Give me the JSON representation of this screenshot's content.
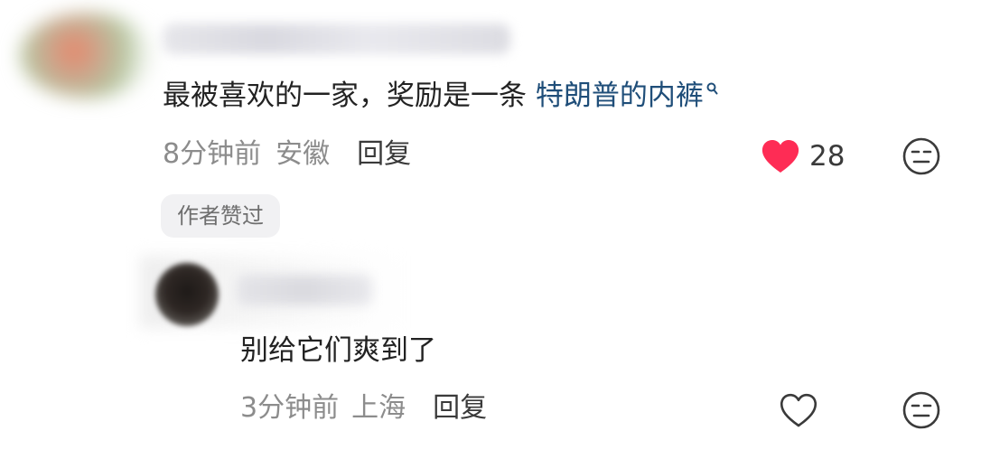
{
  "comment": {
    "text": "最被喜欢的一家，奖励是一条 ",
    "link_text": "特朗普的内裤",
    "time": "8分钟前",
    "location": "安徽",
    "reply_label": "回复",
    "like_count": "28",
    "liked": true,
    "badge": "作者赞过",
    "like_color": "#fe2c55"
  },
  "reply": {
    "text": "别给它们爽到了",
    "time": "3分钟前",
    "location": "上海",
    "reply_label": "回复",
    "liked": false
  },
  "icons": {
    "like": "heart-icon",
    "dislike": "meh-face-icon",
    "search": "search-icon"
  }
}
